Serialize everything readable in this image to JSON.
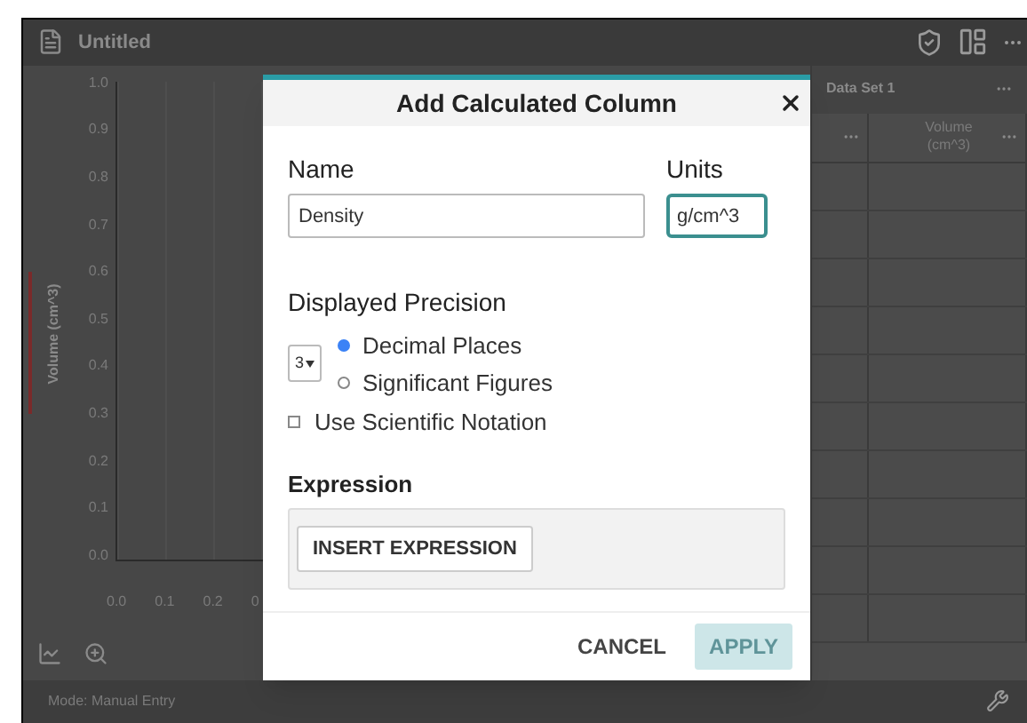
{
  "app": {
    "title": "Untitled"
  },
  "graph": {
    "y_axis_label": "Volume (cm^3)",
    "y_ticks": [
      "1.0",
      "0.9",
      "0.8",
      "0.7",
      "0.6",
      "0.5",
      "0.4",
      "0.3",
      "0.2",
      "0.1",
      "0.0"
    ],
    "x_ticks": [
      "0.0",
      "0.1",
      "0.2",
      "0"
    ]
  },
  "table": {
    "title": "Data Set 1",
    "columns": [
      {},
      {
        "heading": "Volume (cm^3)"
      }
    ]
  },
  "status_bar": {
    "mode": "Mode: Manual Entry"
  },
  "dialog": {
    "title": "Add Calculated Column",
    "name_label": "Name",
    "name_value": "Density",
    "units_label": "Units",
    "units_value": "g/cm^3",
    "units_focused": true,
    "precision_label": "Displayed Precision",
    "precision_value": "3",
    "precision_options": [
      {
        "label": "Decimal Places",
        "selected": true
      },
      {
        "label": "Significant Figures",
        "selected": false
      }
    ],
    "scientific": {
      "label": "Use Scientific Notation",
      "checked": false
    },
    "expression_label": "Expression",
    "insert_button": "INSERT EXPRESSION",
    "cancel": {
      "label": "CANCEL",
      "disabled": false
    },
    "apply": {
      "label": "APPLY",
      "disabled": true
    }
  }
}
